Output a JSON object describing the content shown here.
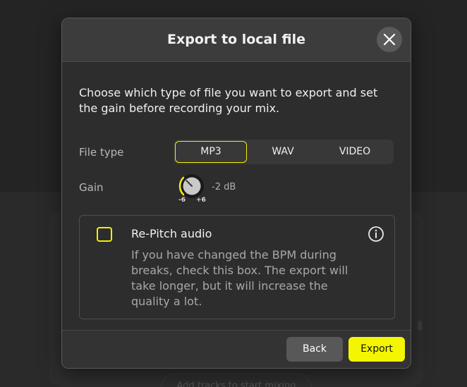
{
  "background": {
    "hint_text": "Add tracks to start mixing"
  },
  "dialog": {
    "title": "Export to local file",
    "intro": "Choose which type of file you want to export and set the gain before recording your mix.",
    "file_type": {
      "label": "File type",
      "options": [
        "MP3",
        "WAV",
        "VIDEO"
      ],
      "selected": "MP3"
    },
    "gain": {
      "label": "Gain",
      "min_label": "-6",
      "max_label": "+6",
      "value_text": "-2 dB",
      "value_db": -2,
      "range_db": [
        -6,
        6
      ]
    },
    "repitch": {
      "title": "Re-Pitch audio",
      "description": "If you have changed the BPM during breaks, check this box. The export will take longer, but it will increase the quality a lot.",
      "checked": false
    },
    "buttons": {
      "back": "Back",
      "export": "Export"
    }
  },
  "icons": {
    "close": "close-icon",
    "info": "info-icon",
    "gain_knob": "knob-icon"
  },
  "colors": {
    "accent": "#f4f500",
    "dialog_bg": "#2d2d2d",
    "header_bg": "#3c3c3c",
    "secondary_button": "#585858"
  }
}
